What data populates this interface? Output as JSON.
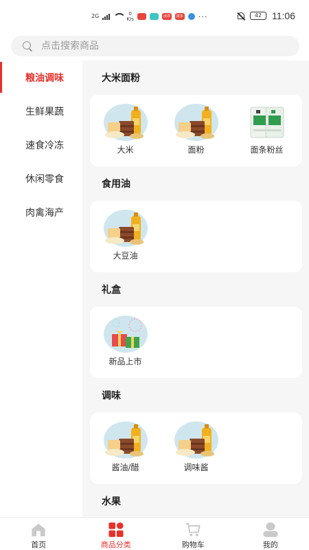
{
  "status_bar": {
    "network": "2G",
    "speed_value": "0",
    "speed_unit": "K/s",
    "app_tag_1": "点评",
    "app_tag_2": "拼多",
    "battery": "42",
    "time": "11:06"
  },
  "search": {
    "placeholder": "点击搜索商品"
  },
  "sidebar": {
    "items": [
      {
        "label": "粮油调味"
      },
      {
        "label": "生鲜果蔬"
      },
      {
        "label": "速食冷冻"
      },
      {
        "label": "休闲零食"
      },
      {
        "label": "肉禽海产"
      }
    ]
  },
  "sections": [
    {
      "title": "大米面粉",
      "products": [
        {
          "name": "大米",
          "icon": "grain-oil-icon"
        },
        {
          "name": "面粉",
          "icon": "grain-oil-icon"
        },
        {
          "name": "面条粉丝",
          "icon": "noodle-pack-icon"
        }
      ]
    },
    {
      "title": "食用油",
      "products": [
        {
          "name": "大豆油",
          "icon": "grain-oil-icon"
        }
      ]
    },
    {
      "title": "礼盒",
      "products": [
        {
          "name": "新品上市",
          "icon": "gift-box-icon"
        }
      ]
    },
    {
      "title": "调味",
      "products": [
        {
          "name": "酱油/醋",
          "icon": "grain-oil-icon"
        },
        {
          "name": "调味酱",
          "icon": "grain-oil-icon"
        }
      ]
    },
    {
      "title": "水果"
    }
  ],
  "tabbar": {
    "tabs": [
      {
        "label": "首页"
      },
      {
        "label": "商品分类"
      },
      {
        "label": "购物车"
      },
      {
        "label": "我的"
      }
    ]
  },
  "colors": {
    "accent": "#e8312b",
    "content_bg": "#f6f6f6"
  }
}
